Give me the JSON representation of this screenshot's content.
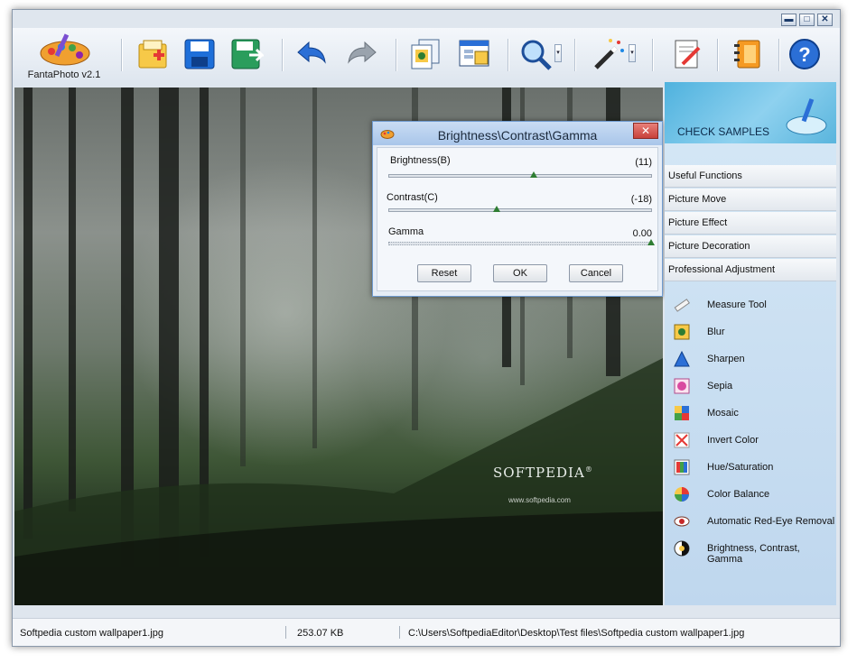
{
  "app": {
    "logo_label": "FantaPhoto v2.1"
  },
  "window_controls": {
    "minimize": "▬",
    "maximize": "□",
    "close": "✕"
  },
  "toolbar": {
    "open": "open-file-icon",
    "save": "save-icon",
    "save_as": "save-as-icon",
    "undo": "undo-icon",
    "redo": "redo-icon",
    "copy": "copy-icon",
    "window": "window-icon",
    "zoom": "zoom-icon",
    "wand": "magic-wand-icon",
    "edit": "edit-icon",
    "book": "book-icon",
    "help": "help-icon",
    "help_glyph": "?",
    "dropdown_glyph": "▾"
  },
  "canvas": {
    "watermark_title": "SOFTPEDIA",
    "watermark_reg": "®",
    "watermark_url": "www.softpedia.com"
  },
  "dialog": {
    "title": "Brightness\\Contrast\\Gamma",
    "close_glyph": "✕",
    "sliders": [
      {
        "label": "Brightness(B)",
        "value": "(11)",
        "position": 0.55
      },
      {
        "label": "Contrast(C)",
        "value": "(-18)",
        "position": 0.41
      },
      {
        "label": "Gamma",
        "value": "0.00",
        "position": 1.0
      }
    ],
    "buttons": {
      "reset": "Reset",
      "ok": "OK",
      "cancel": "Cancel"
    }
  },
  "panel": {
    "check_samples": "CHECK SAMPLES",
    "categories": [
      "Useful Functions",
      "Picture Move",
      "Picture Effect",
      "Picture Decoration",
      "Professional Adjustment"
    ],
    "tools": [
      {
        "label": "Measure Tool",
        "icon": "measure-tool-icon"
      },
      {
        "label": "Blur",
        "icon": "blur-icon"
      },
      {
        "label": "Sharpen",
        "icon": "sharpen-icon"
      },
      {
        "label": "Sepia",
        "icon": "sepia-icon"
      },
      {
        "label": "Mosaic",
        "icon": "mosaic-icon"
      },
      {
        "label": "Invert Color",
        "icon": "invert-color-icon"
      },
      {
        "label": "Hue/Saturation",
        "icon": "hue-saturation-icon"
      },
      {
        "label": "Color Balance",
        "icon": "color-balance-icon"
      },
      {
        "label": "Automatic Red-Eye Removal",
        "icon": "red-eye-icon"
      },
      {
        "label": "Brightness, Contrast, Gamma",
        "icon": "brightness-contrast-icon"
      }
    ]
  },
  "status": {
    "filename": "Softpedia custom wallpaper1.jpg",
    "filesize": "253.07 KB",
    "path": "C:\\Users\\SoftpediaEditor\\Desktop\\Test files\\Softpedia custom wallpaper1.jpg"
  },
  "colors": {
    "accent": "#2b6fd6",
    "slider_thumb": "#2e7d32",
    "panel_bg": "#cfe2f3"
  }
}
